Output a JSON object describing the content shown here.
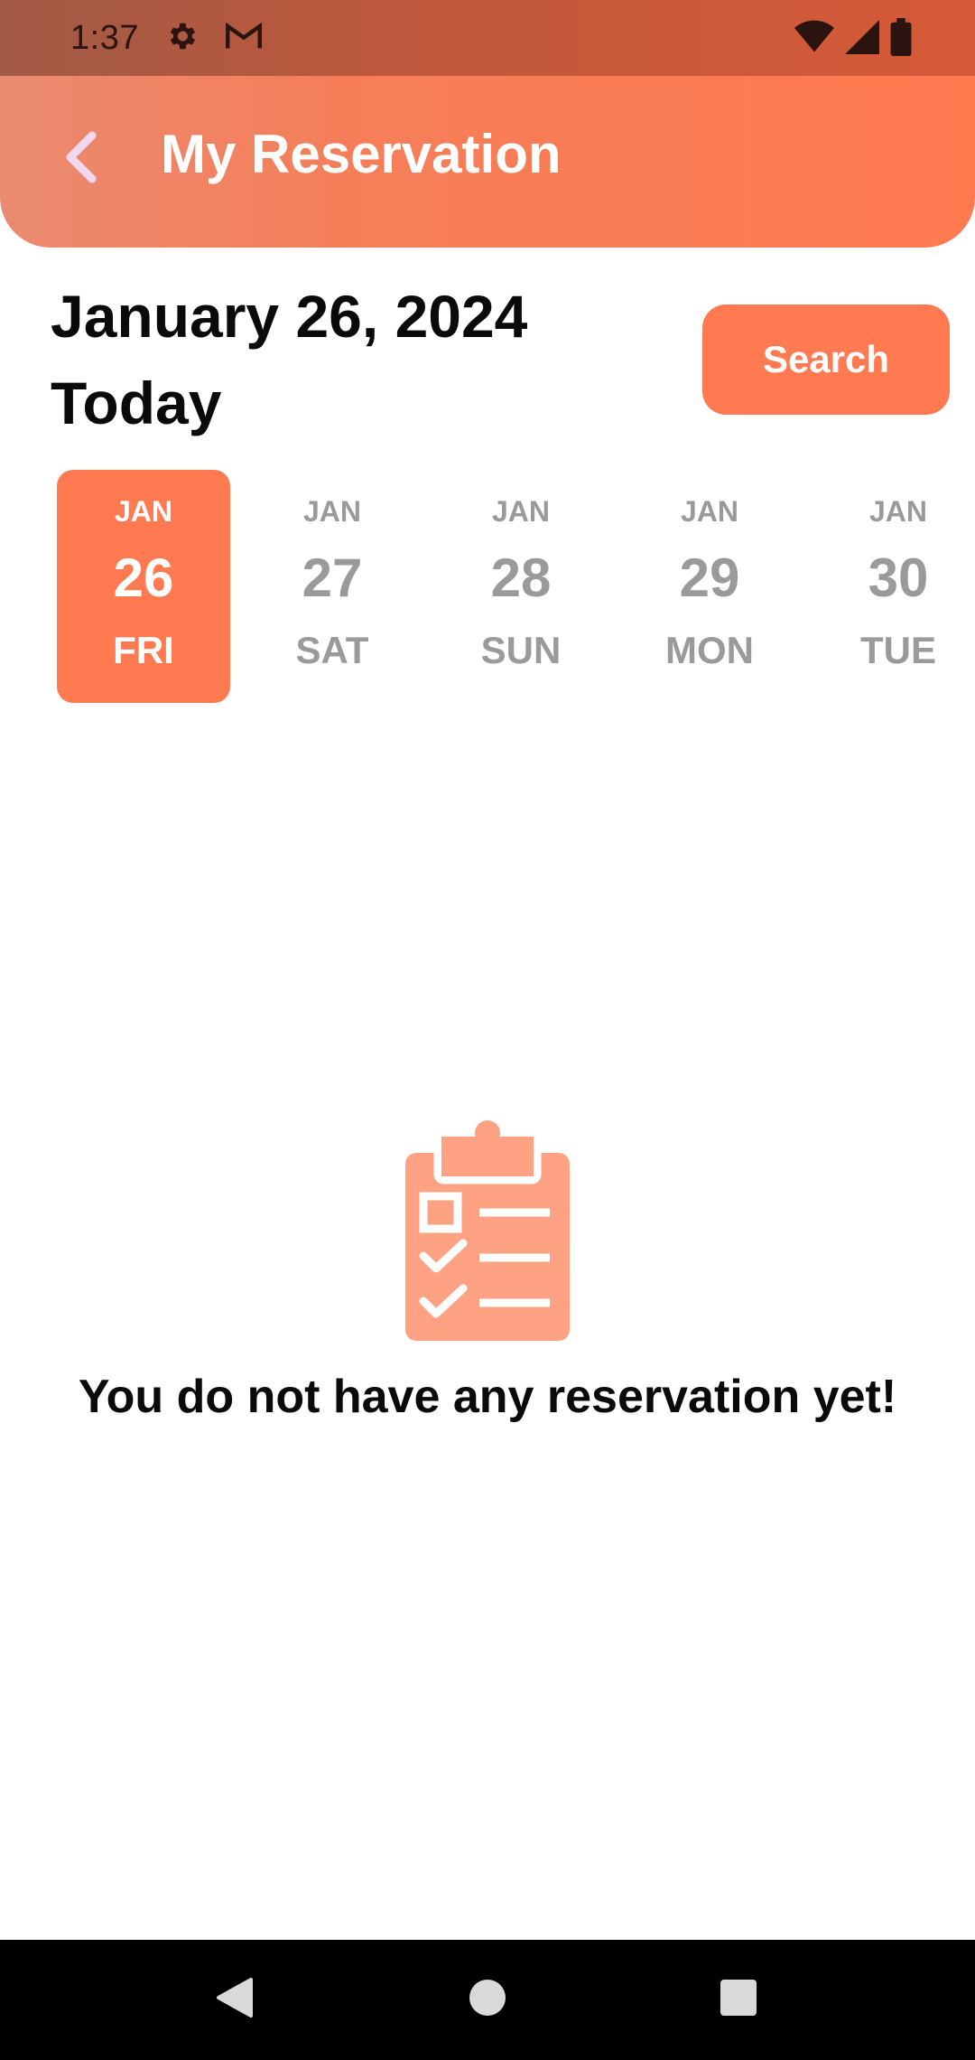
{
  "status_bar": {
    "time": "1:37",
    "left_icons": [
      "gear-icon",
      "gmail-icon"
    ],
    "right_icons": [
      "wifi-icon",
      "signal-icon",
      "battery-icon"
    ]
  },
  "app_bar": {
    "title": "My Reservation",
    "back_icon": "chevron-left-icon"
  },
  "header": {
    "date": "January 26, 2024",
    "subtitle": "Today",
    "search_label": "Search"
  },
  "days": [
    {
      "month": "JAN",
      "day": "26",
      "weekday": "FRI",
      "selected": true
    },
    {
      "month": "JAN",
      "day": "27",
      "weekday": "SAT",
      "selected": false
    },
    {
      "month": "JAN",
      "day": "28",
      "weekday": "SUN",
      "selected": false
    },
    {
      "month": "JAN",
      "day": "29",
      "weekday": "MON",
      "selected": false
    },
    {
      "month": "JAN",
      "day": "30",
      "weekday": "TUE",
      "selected": false
    }
  ],
  "empty_state": {
    "icon": "clipboard-checklist-icon",
    "message": "You do not have any reservation yet!"
  },
  "nav_bar": {
    "buttons": [
      "back-triangle-icon",
      "home-circle-icon",
      "recents-square-icon"
    ]
  },
  "colors": {
    "accent": "#ff7a50",
    "muted_text": "#9a9a9a",
    "icon_fill": "#ffa183"
  }
}
